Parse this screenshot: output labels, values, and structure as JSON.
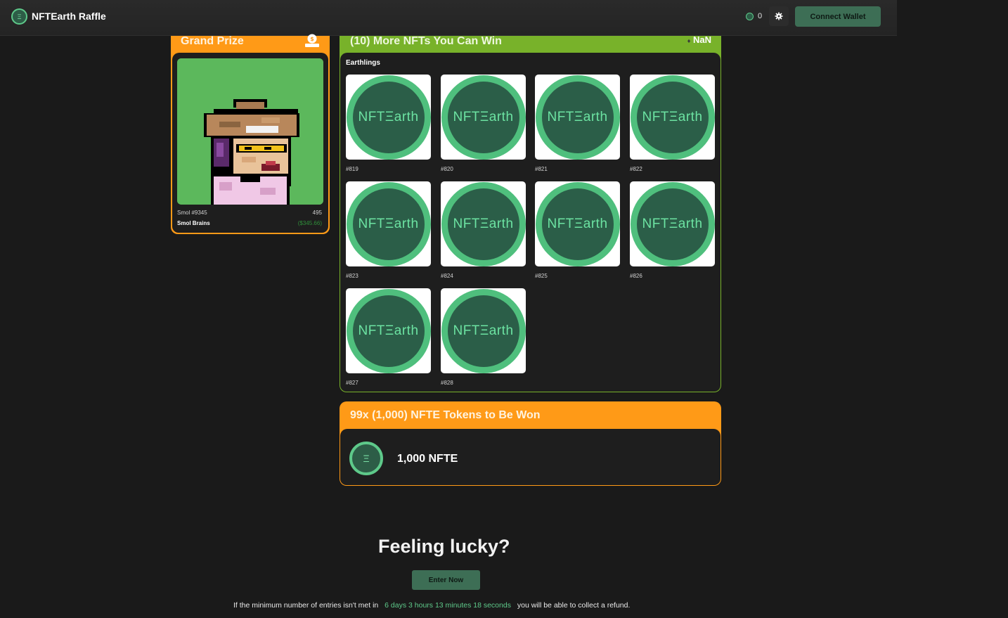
{
  "header": {
    "title": "NFTEarth Raffle",
    "logo_glyph": "Ξ",
    "balance": "0",
    "connect_label": "Connect Wallet"
  },
  "grand_prize": {
    "title": "Grand Prize",
    "name": "Smol #9345",
    "price": "495",
    "collection": "Smol Brains",
    "usd": "($345.66)"
  },
  "more_nfts": {
    "title": "(10) More NFTs You Can Win",
    "value": "NaN",
    "collection": "Earthlings",
    "coin_text": "NFTΞarth",
    "items": [
      "#819",
      "#820",
      "#821",
      "#822",
      "#823",
      "#824",
      "#825",
      "#826",
      "#827",
      "#828"
    ]
  },
  "tokens": {
    "title": "99x (1,000) NFTE Tokens to Be Won",
    "coin_glyph": "Ξ",
    "amount": "1,000 NFTE"
  },
  "cta": {
    "heading": "Feeling lucky?",
    "enter_label": "Enter Now",
    "refund_prefix": "If the minimum number of entries isn't met in",
    "countdown": "6 days 3 hours 13 minutes 18 seconds",
    "refund_suffix": "you will be able to collect a refund."
  },
  "colors": {
    "accent_green": "#3d6e55",
    "orange": "#ff9a17",
    "lime": "#78b22a"
  }
}
